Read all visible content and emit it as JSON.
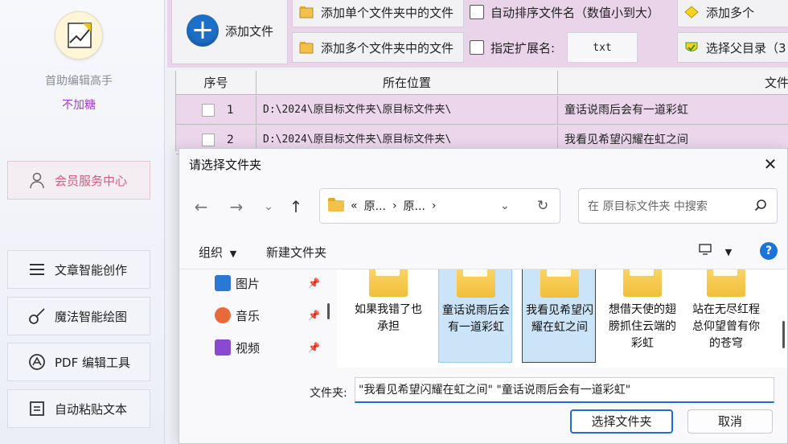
{
  "app": {
    "name": "首助编辑高手",
    "subtitle": "不加糖",
    "member_center": "会员服务中心",
    "menu": [
      {
        "label": "文章智能创作",
        "icon": "list-icon"
      },
      {
        "label": "魔法智能绘图",
        "icon": "brush-icon"
      },
      {
        "label": "PDF 编辑工具",
        "icon": "pdf-icon"
      },
      {
        "label": "自动粘贴文本",
        "icon": "paste-icon"
      }
    ]
  },
  "toolbar": {
    "add_file": "添加文件",
    "add_single_folder": "添加单个文件夹中的文件",
    "add_multi_folder": "添加多个文件夹中的文件",
    "auto_sort": "自动排序文件名（数值小到大）",
    "specify_ext": "指定扩展名:",
    "ext_value": "txt",
    "add_multi_short": "添加多个",
    "choose_parent": "选择父目录（3"
  },
  "table": {
    "headers": [
      "序号",
      "所在位置",
      "文件"
    ],
    "rows": [
      {
        "index": "1",
        "location": "D:\\2024\\原目标文件夹\\原目标文件夹\\",
        "name": "童话说雨后会有一道彩虹"
      },
      {
        "index": "2",
        "location": "D:\\2024\\原目标文件夹\\原目标文件夹\\",
        "name": "我看见希望闪耀在虹之间"
      }
    ]
  },
  "dialog": {
    "title": "请选择文件夹",
    "breadcrumb": [
      "原...",
      "原..."
    ],
    "breadcrumb_prefix": "«",
    "search_placeholder": "在 原目标文件夹 中搜索",
    "organize": "组织",
    "new_folder": "新建文件夹",
    "nav_items": [
      {
        "label": "图片",
        "color": "#2a78d6"
      },
      {
        "label": "音乐",
        "color": "#e86a3a"
      },
      {
        "label": "视频",
        "color": "#8a4ad0"
      }
    ],
    "folders": [
      {
        "label": "如果我错了也承担",
        "selected": false
      },
      {
        "label": "童话说雨后会有一道彩虹",
        "selected": true
      },
      {
        "label": "我看见希望闪耀在虹之间",
        "selected": true
      },
      {
        "label": "想借天使的翅膀抓住云端的彩虹",
        "selected": false
      },
      {
        "label": "站在无尽红程总仰望曾有你的苍穹",
        "selected": false
      }
    ],
    "folder_field_label": "文件夹:",
    "folder_field_value": "\"我看见希望闪耀在虹之间\" \"童话说雨后会有一道彩虹\"",
    "select_button": "选择文件夹",
    "cancel_button": "取消"
  },
  "colors": {
    "accent": "#1a6fd0",
    "toolbar_bg": "#e9d4ea",
    "member_text": "#e0587a",
    "subtitle_text": "#a040c8"
  }
}
